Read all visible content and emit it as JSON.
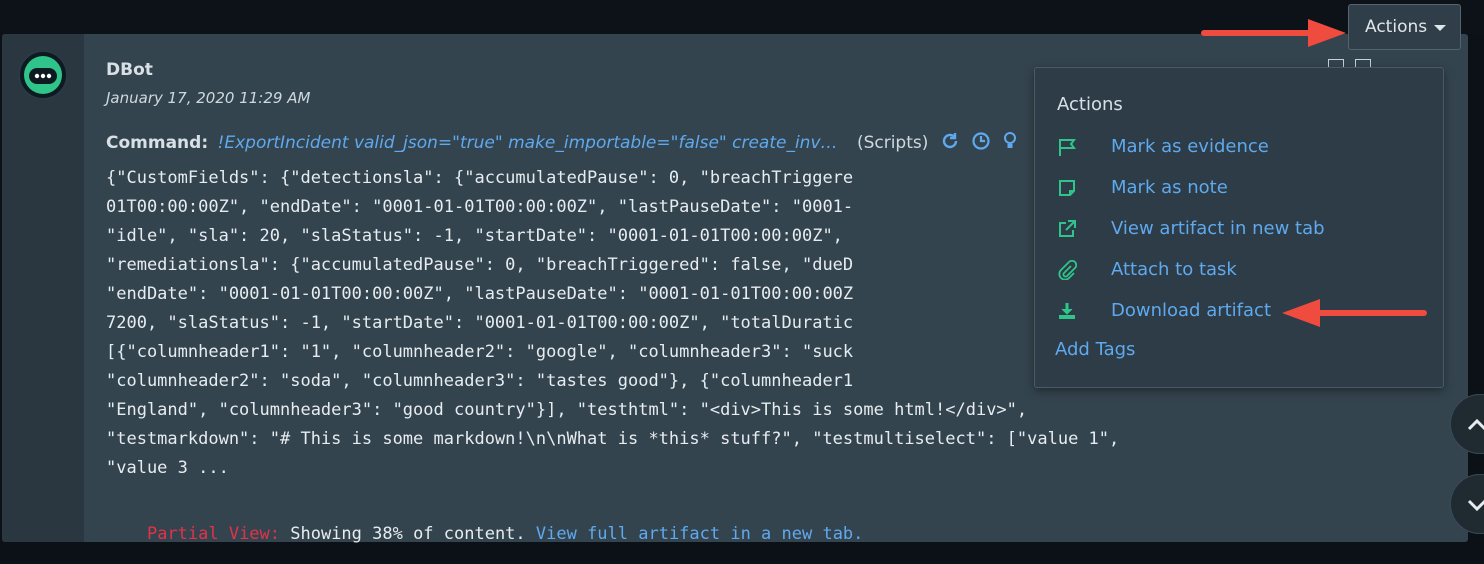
{
  "header": {
    "actions_label": "Actions"
  },
  "entry": {
    "author": "DBot",
    "timestamp": "January 17, 2020 11:29 AM",
    "command_label": "Command:",
    "command_text": "!ExportIncident valid_json=\"true\" make_importable=\"false\" create_inv…",
    "command_brand": "(Scripts)",
    "content_lines": [
      "{\"CustomFields\": {\"detectionsla\": {\"accumulatedPause\": 0, \"breachTriggere",
      "01T00:00:00Z\", \"endDate\": \"0001-01-01T00:00:00Z\", \"lastPauseDate\": \"0001-",
      "\"idle\", \"sla\": 20, \"slaStatus\": -1, \"startDate\": \"0001-01-01T00:00:00Z\",",
      "\"remediationsla\": {\"accumulatedPause\": 0, \"breachTriggered\": false, \"dueD",
      "\"endDate\": \"0001-01-01T00:00:00Z\", \"lastPauseDate\": \"0001-01-01T00:00:00Z",
      "7200, \"slaStatus\": -1, \"startDate\": \"0001-01-01T00:00:00Z\", \"totalDuratic",
      "[{\"columnheader1\": \"1\", \"columnheader2\": \"google\", \"columnheader3\": \"suck",
      "\"columnheader2\": \"soda\", \"columnheader3\": \"tastes good\"}, {\"columnheader1",
      "\"England\", \"columnheader3\": \"good country\"}], \"testhtml\": \"<div>This is some html!</div>\",",
      "\"testmarkdown\": \"# This is some markdown!\\n\\nWhat is *this* stuff?\", \"testmultiselect\": [\"value 1\",",
      "\"value 3 ..."
    ],
    "partial_label": "Partial View:",
    "partial_text": " Showing 38% of content. ",
    "partial_link": "View full artifact in a new tab."
  },
  "menu": {
    "title": "Actions",
    "items": [
      {
        "label": "Mark as evidence",
        "icon": "flag-icon"
      },
      {
        "label": "Mark as note",
        "icon": "note-icon"
      },
      {
        "label": "View artifact in new tab",
        "icon": "external-link-icon"
      },
      {
        "label": "Attach to task",
        "icon": "paperclip-icon"
      },
      {
        "label": "Download artifact",
        "icon": "download-icon"
      }
    ],
    "add_tags": "Add Tags"
  },
  "colors": {
    "accent_link": "#5fa9ee",
    "icon_green": "#2fc58a",
    "partial_red": "#e0334a",
    "annotation_arrow": "#ef4b3f"
  }
}
